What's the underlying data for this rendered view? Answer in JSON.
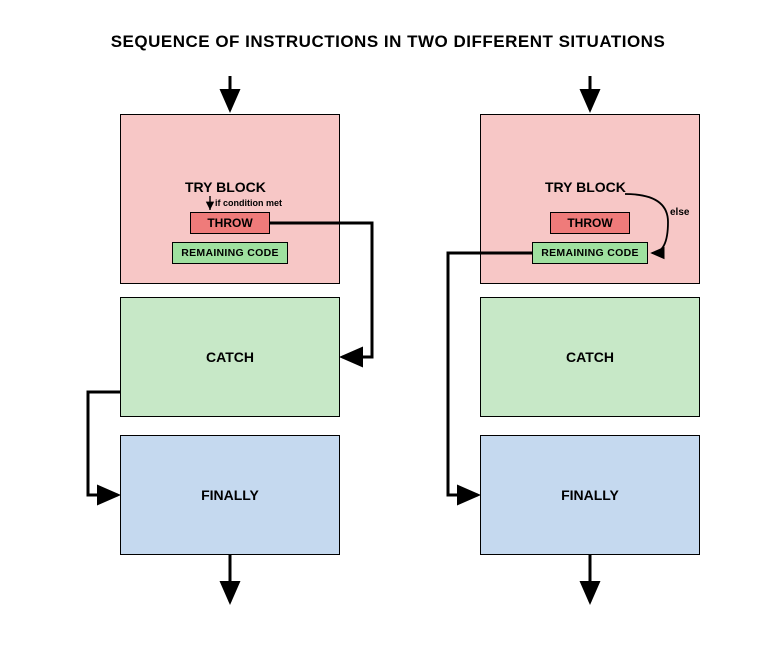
{
  "title": "SEQUENCE OF INSTRUCTIONS IN TWO DIFFERENT SITUATIONS",
  "left": {
    "try_label": "TRY BLOCK",
    "condition_note": "if condition met",
    "throw_label": "THROW",
    "remaining_label": "REMAINING CODE",
    "catch_label": "CATCH",
    "finally_label": "FINALLY"
  },
  "right": {
    "try_label": "TRY BLOCK",
    "else_note": "else",
    "throw_label": "THROW",
    "remaining_label": "REMAINING CODE",
    "catch_label": "CATCH",
    "finally_label": "FINALLY"
  }
}
